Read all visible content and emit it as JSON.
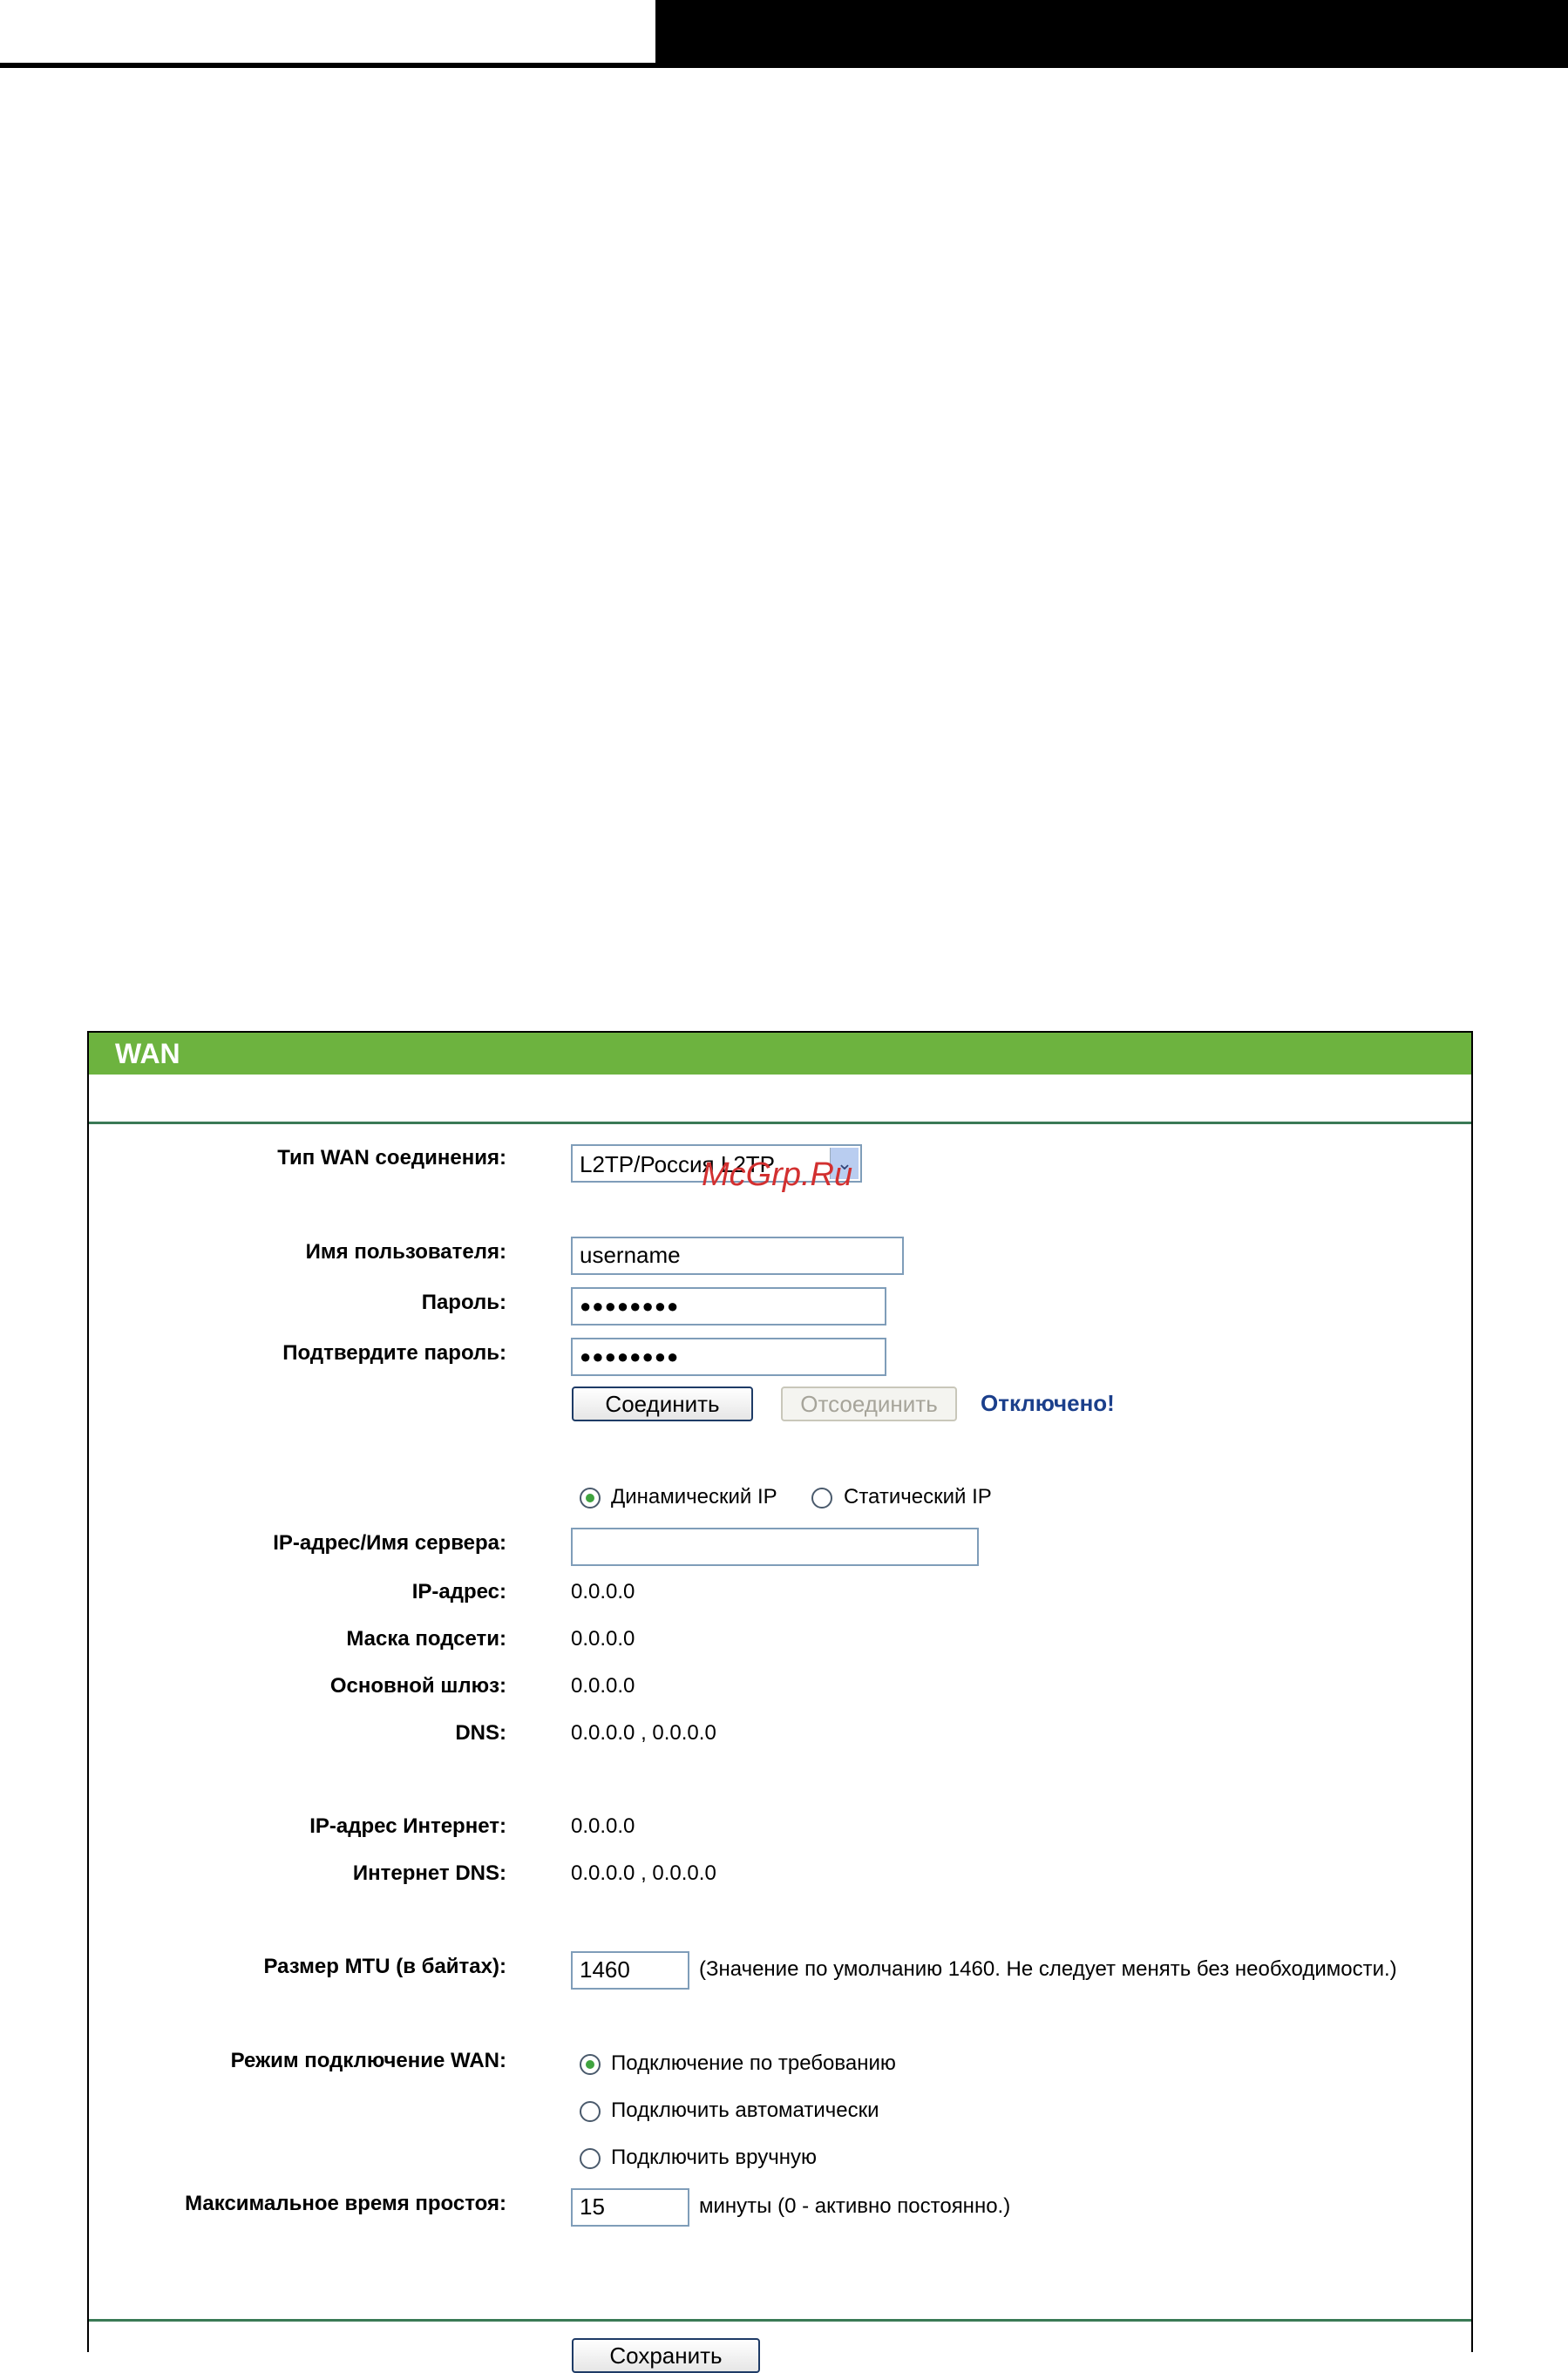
{
  "panel": {
    "title": "WAN"
  },
  "watermark": "McGrp.Ru",
  "connection": {
    "type_label": "Тип WAN соединения:",
    "type_value": "L2TP/Россия L2TP",
    "arrow": "chevron-down-icon"
  },
  "credentials": {
    "username_label": "Имя пользователя:",
    "username_value": "username",
    "password_label": "Пароль:",
    "password_value": "●●●●●●●●",
    "confirm_label": "Подтвердите пароль:",
    "confirm_value": "●●●●●●●●",
    "connect_button": "Соединить",
    "disconnect_button": "Отсоединить",
    "status": "Отключено!"
  },
  "ip_mode": {
    "dynamic": "Динамический IP",
    "static": "Статический IP",
    "selected": "dynamic"
  },
  "server": {
    "label": "IP-адрес/Имя сервера:",
    "value": ""
  },
  "info": {
    "ip_label": "IP-адрес:",
    "ip_value": "0.0.0.0",
    "mask_label": "Маска подсети:",
    "mask_value": "0.0.0.0",
    "gateway_label": "Основной шлюз:",
    "gateway_value": "0.0.0.0",
    "dns_label": "DNS:",
    "dns_value": "0.0.0.0 , 0.0.0.0",
    "inet_ip_label": "IP-адрес Интернет:",
    "inet_ip_value": "0.0.0.0",
    "inet_dns_label": "Интернет DNS:",
    "inet_dns_value": "0.0.0.0 , 0.0.0.0"
  },
  "mtu": {
    "label": "Размер MTU (в байтах):",
    "value": "1460",
    "hint": "(Значение по умолчанию 1460. Не следует менять без необходимости.)"
  },
  "wan_mode": {
    "label": "Режим подключение WAN:",
    "options": [
      "Подключение по требованию",
      "Подключить автоматически",
      "Подключить вручную"
    ],
    "selected_index": 0
  },
  "idle": {
    "label": "Максимальное время простоя:",
    "value": "15",
    "hint": "минуты (0 - активно постоянно.)"
  },
  "save_button": "Сохранить"
}
